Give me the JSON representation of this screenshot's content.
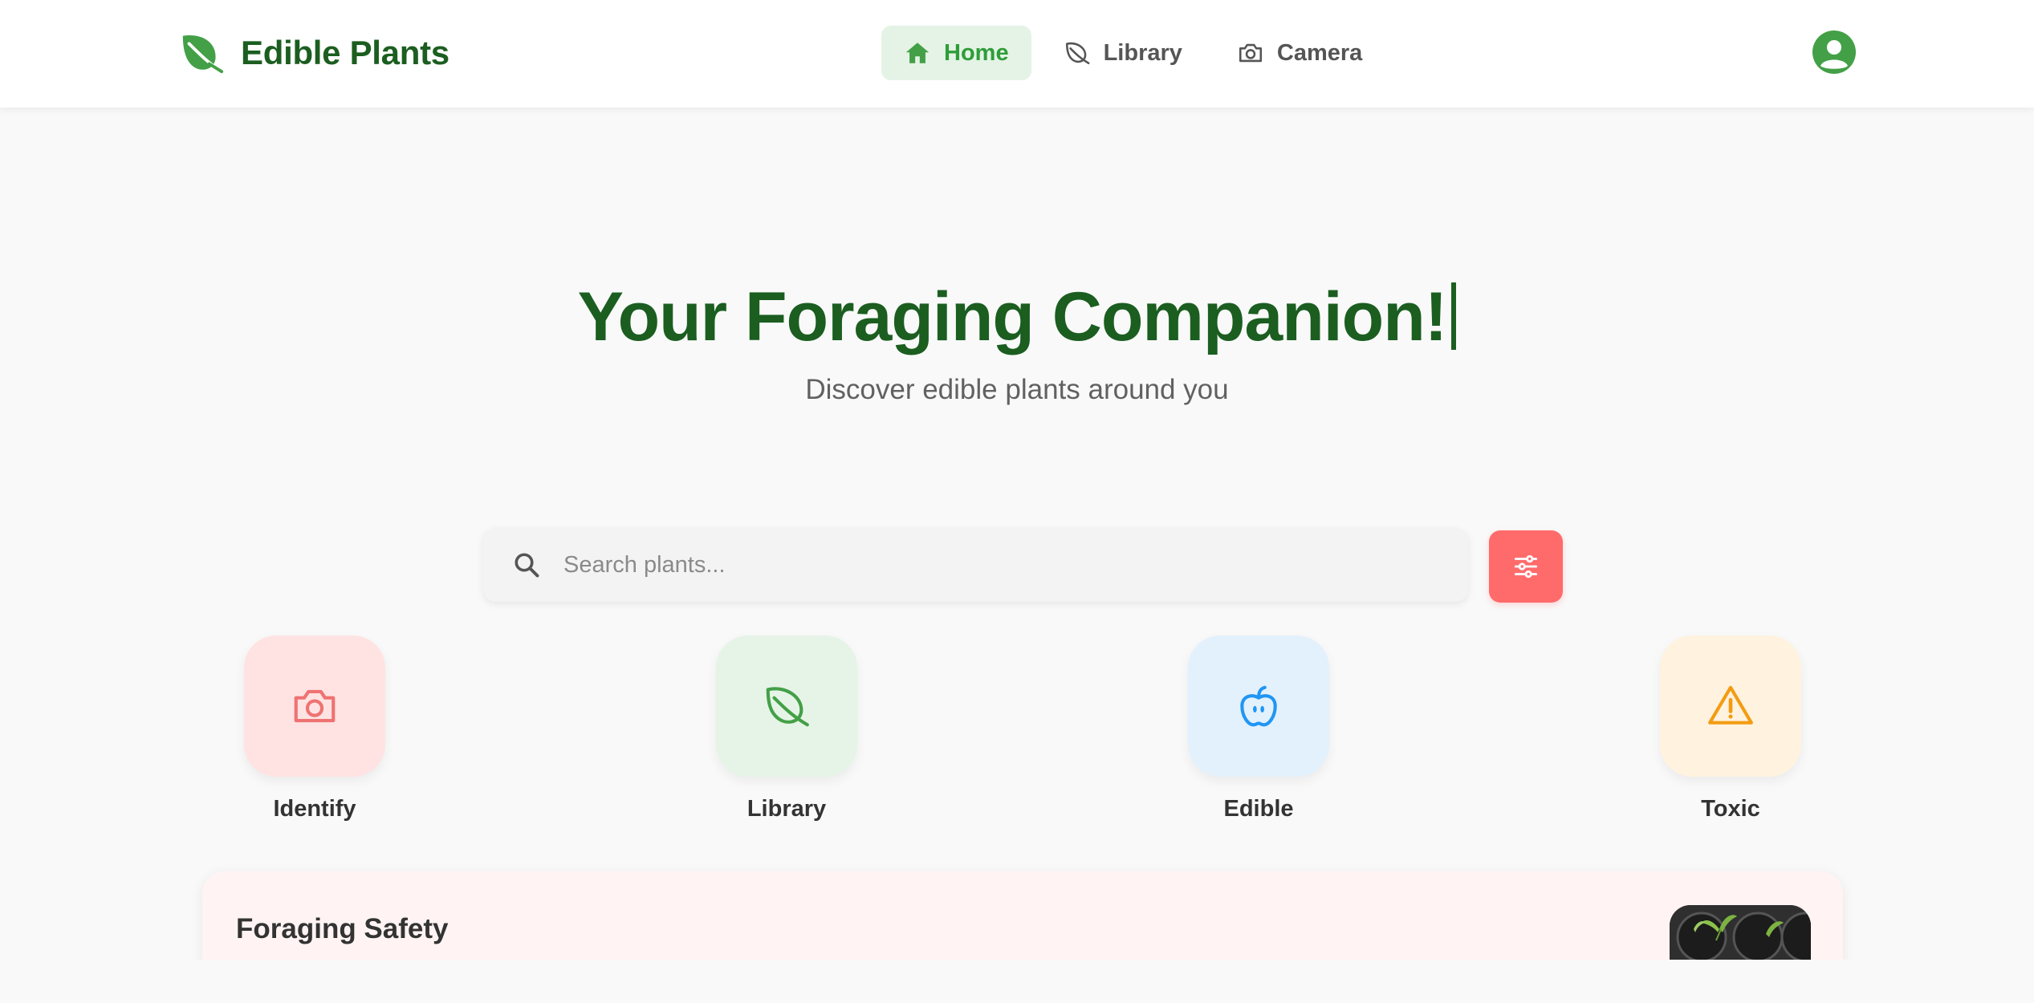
{
  "app": {
    "name": "Edible Plants",
    "logo_icon": "leaf-icon",
    "brand_color": "#1b5e20",
    "accent_color": "#2e9d3a"
  },
  "nav": {
    "items": [
      {
        "label": "Home",
        "icon": "home-icon",
        "active": true
      },
      {
        "label": "Library",
        "icon": "leaf-outline-icon",
        "active": false
      },
      {
        "label": "Camera",
        "icon": "camera-icon",
        "active": false
      }
    ],
    "user_icon": "user-avatar-icon"
  },
  "hero": {
    "title": "Your Foraging Companion!",
    "subtitle": "Discover edible plants around you"
  },
  "search": {
    "placeholder": "Search plants...",
    "value": "",
    "icon": "search-icon",
    "filter_icon": "sliders-icon",
    "filter_color": "#ff6b6b"
  },
  "quick_actions": [
    {
      "label": "Identify",
      "icon": "camera-icon",
      "tile_color": "#ffe3e3",
      "icon_color": "#ef7272"
    },
    {
      "label": "Library",
      "icon": "leaf-icon",
      "tile_color": "#e6f4e7",
      "icon_color": "#43a047"
    },
    {
      "label": "Edible",
      "icon": "apple-icon",
      "tile_color": "#e3f1fd",
      "icon_color": "#2196f3"
    },
    {
      "label": "Toxic",
      "icon": "warning-icon",
      "tile_color": "#fff2df",
      "icon_color": "#f39c12"
    }
  ],
  "safety_card": {
    "title": "Foraging Safety",
    "image_icon": "seedlings-photo"
  }
}
